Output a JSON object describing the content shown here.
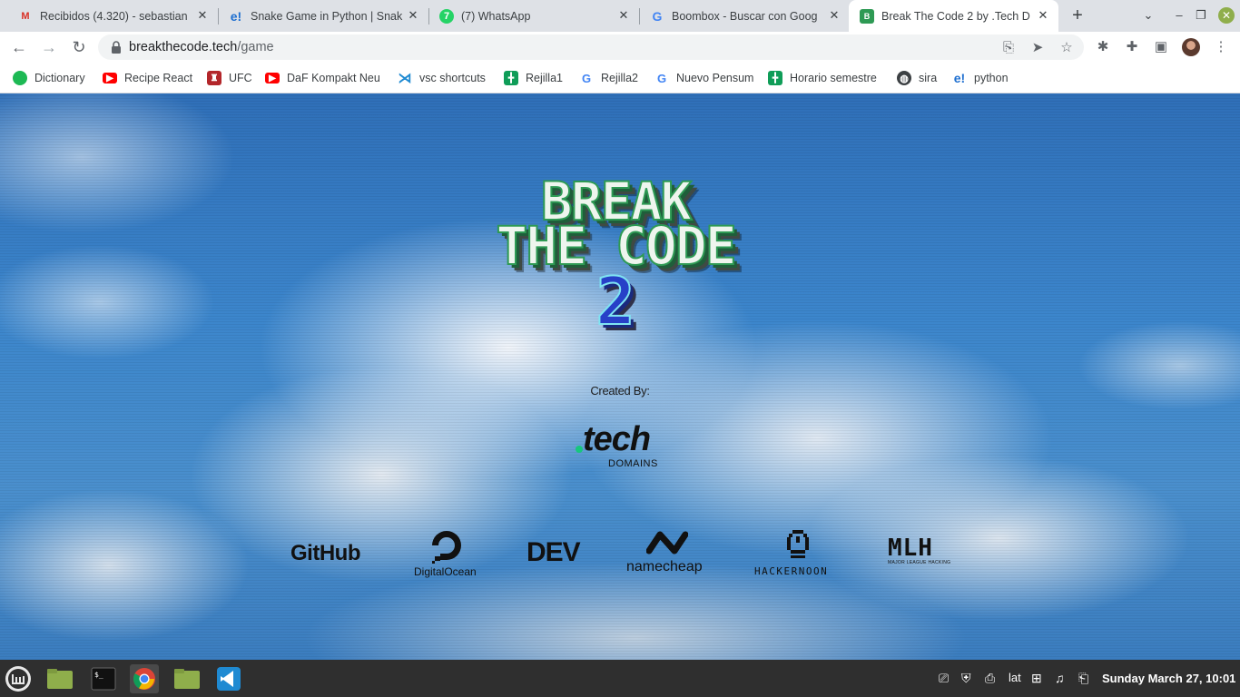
{
  "tabs": [
    {
      "title": "Recibidos (4.320) - sebastian",
      "icon": "gmail-icon"
    },
    {
      "title": "Snake Game in Python | Snak",
      "icon": "edureka-icon"
    },
    {
      "title": "(7) WhatsApp",
      "icon": "whatsapp-icon"
    },
    {
      "title": "Boombox - Buscar con Goog",
      "icon": "google-icon"
    },
    {
      "title": "Break The Code 2 by .Tech D",
      "icon": "btc-icon",
      "active": true
    }
  ],
  "address": {
    "domain": "breakthecode.tech",
    "path": "/game"
  },
  "bookmarks": [
    {
      "label": "Dictionary",
      "icon": "green-circle-icon"
    },
    {
      "label": "Recipe React",
      "icon": "youtube-icon"
    },
    {
      "label": "UFC",
      "icon": "ufc-icon"
    },
    {
      "label": "DaF Kompakt Neu",
      "icon": "youtube-icon"
    },
    {
      "label": "vsc shortcuts",
      "icon": "vscode-icon"
    },
    {
      "label": "Rejilla1",
      "icon": "sheets-icon"
    },
    {
      "label": "Rejilla2",
      "icon": "google-icon"
    },
    {
      "label": "Nuevo Pensum",
      "icon": "google-icon"
    },
    {
      "label": "Horario semestre",
      "icon": "sheets-icon"
    },
    {
      "label": "sira",
      "icon": "globe-icon"
    },
    {
      "label": "python",
      "icon": "edureka-icon"
    }
  ],
  "page": {
    "logo": {
      "line1": "BREAK",
      "line2": "THE CODE",
      "line3": "2"
    },
    "created_by": "Created By:",
    "creator": {
      "word": "tech",
      "sub": "DOMAINS"
    },
    "sponsors": {
      "github": "GitHub",
      "digitalocean": "DigitalOcean",
      "dev": "DEV",
      "namecheap": "namecheap",
      "hackernoon": "HACKERNOON",
      "mlh": "MLH",
      "mlh_sub": "MAJOR LEAGUE HACKING"
    }
  },
  "taskbar": {
    "keyboard": "lat",
    "clock": "Sunday March 27, 10:01"
  }
}
